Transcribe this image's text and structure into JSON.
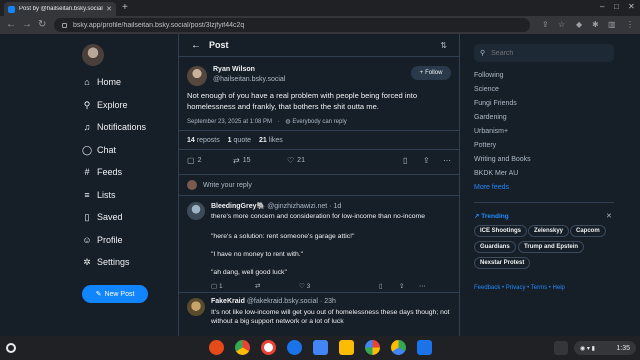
{
  "browser": {
    "tab_title": "Post by @hailseitan.bsky.social",
    "url": "bsky.app/profile/hailseitan.bsky.social/post/3lzjfyif44c2q"
  },
  "nav": {
    "items": [
      {
        "label": "Home",
        "icon": "home-icon"
      },
      {
        "label": "Explore",
        "icon": "search-icon"
      },
      {
        "label": "Notifications",
        "icon": "bell-icon"
      },
      {
        "label": "Chat",
        "icon": "chat-icon"
      },
      {
        "label": "Feeds",
        "icon": "hash-icon"
      },
      {
        "label": "Lists",
        "icon": "list-icon"
      },
      {
        "label": "Saved",
        "icon": "bookmark-icon"
      },
      {
        "label": "Profile",
        "icon": "user-icon"
      },
      {
        "label": "Settings",
        "icon": "gear-icon"
      }
    ],
    "new_post": "New Post"
  },
  "header": {
    "title": "Post"
  },
  "post": {
    "author_name": "Ryan Wilson",
    "author_handle": "@hailseitan.bsky.social",
    "follow_label": "Follow",
    "text": "Not enough of you have a real problem with people being forced into homelessness and frankly, that bothers the shit outta me.",
    "date": "September 23, 2025 at 1:08 PM",
    "reply_setting": "Everybody can reply",
    "reposts_count": "14",
    "reposts_label": "reposts",
    "quotes_count": "1",
    "quotes_label": "quote",
    "likes_count": "21",
    "likes_label": "likes",
    "reply_count": "2",
    "repost_action_count": "15",
    "like_action_count": "21",
    "write_reply": "Write your reply"
  },
  "replies": [
    {
      "name": "BleedingGrey🐘",
      "handle": "@ginzhizhawizi.net",
      "age": "1d",
      "lines": [
        "there's more concern and consideration for low-income than no-income",
        "\"here's a solution: rent someone's garage attic!\"",
        "\"I have no money to rent with.\"",
        "\"ah dang, well good luck\""
      ],
      "replies": "1",
      "likes": "3"
    },
    {
      "name": "FakeKraid",
      "handle": "@fakekraid.bsky.social",
      "age": "23h",
      "lines": [
        "It's not like low-income will get you out of homelessness these days though; not without a big support network or a lot of luck"
      ]
    }
  ],
  "right": {
    "search_placeholder": "Search",
    "feeds": [
      "Following",
      "Science",
      "Fungi Friends",
      "Gardening",
      "Urbanism+",
      "Pottery",
      "Writing and Books",
      "BKDK Mer AU"
    ],
    "more_feeds": "More feeds",
    "trending_label": "Trending",
    "trending": [
      "ICE Shootings",
      "Zelenskyy",
      "Capcom",
      "Guardians",
      "Trump and Epstein",
      "Nexstar Protest"
    ],
    "footer": "Feedback • Privacy • Terms • Help"
  },
  "shelf": {
    "time": "1:35"
  }
}
